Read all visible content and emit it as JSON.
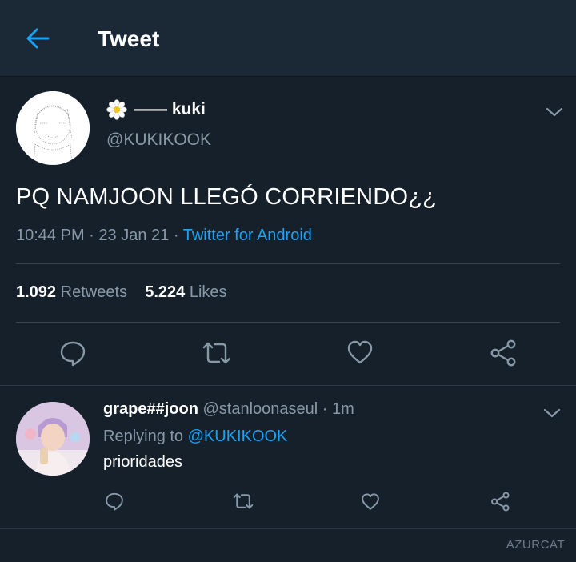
{
  "header": {
    "title": "Tweet"
  },
  "tweet": {
    "display_name": "—— kuki",
    "handle": "@KUKIKOOK",
    "text": "PQ NAMJOON LLEGÓ CORRIENDO¿¿",
    "time": "10:44 PM",
    "date": "23 Jan 21",
    "separator": "·",
    "source": "Twitter for Android",
    "retweets_count": "1.092",
    "retweets_label": "Retweets",
    "likes_count": "5.224",
    "likes_label": "Likes"
  },
  "reply": {
    "name": "grape##joon",
    "handle": "@stanloonaseul",
    "time": "· 1m",
    "replying_prefix": "Replying to",
    "replying_to": "@KUKIKOOK",
    "text": "prioridades"
  },
  "watermark": "AZURCAT",
  "colors": {
    "background": "#15202b",
    "header": "#1b2836",
    "accent": "#1da1f2",
    "muted": "#8899a6"
  }
}
